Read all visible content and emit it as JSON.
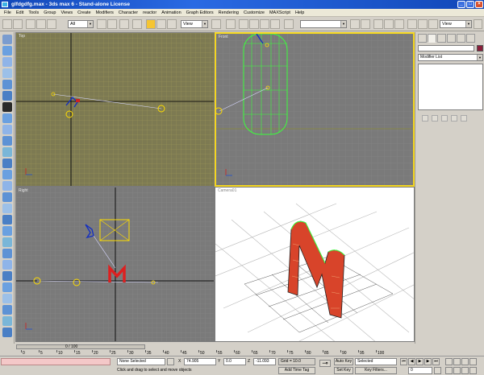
{
  "window": {
    "title": "glfdgdfg.max - 3ds max 6 - Stand-alone License",
    "controls": [
      "_",
      "□",
      "×"
    ]
  },
  "menu": [
    "File",
    "Edit",
    "Tools",
    "Group",
    "Views",
    "Create",
    "Modifiers",
    "Character",
    "reactor",
    "Animation",
    "Graph Editors",
    "Rendering",
    "Customize",
    "MAXScript",
    "Help"
  ],
  "toolbar": {
    "selection_filter": "All",
    "reference_coord": "View",
    "named_selection": "",
    "render_view": "View"
  },
  "viewports": {
    "top": "Top",
    "front": "Front",
    "right": "Right",
    "camera": "Camera01"
  },
  "command_panel": {
    "modifier_list": "Modifier List"
  },
  "timeline": {
    "frame_counter": "0 / 100",
    "ticks": [
      "0",
      "5",
      "10",
      "15",
      "20",
      "25",
      "30",
      "35",
      "40",
      "45",
      "50",
      "55",
      "60",
      "65",
      "70",
      "75",
      "80",
      "85",
      "90",
      "95",
      "100"
    ]
  },
  "status": {
    "selection": "None Selected",
    "prompt": "Click and drag to select and move objects",
    "x_label": "X",
    "x_value": "74.905",
    "y_label": "Y",
    "y_value": "0.0",
    "z_label": "Z",
    "z_value": "-11.093",
    "grid": "Grid = 10.0",
    "add_time_tag": "Add Time Tag",
    "auto_key": "Auto Key",
    "set_key": "Set Key",
    "key_mode": "Selected",
    "key_filters": "Key Filters...",
    "current_frame": "0"
  },
  "colors": {
    "title_bar": "#1147b8",
    "viewport_bg": "#7a7a7a",
    "top_grid": "#a09a5a",
    "active_border": "#f4d61f",
    "object_red": "#cc2222",
    "wire_green": "#3cff3c"
  }
}
